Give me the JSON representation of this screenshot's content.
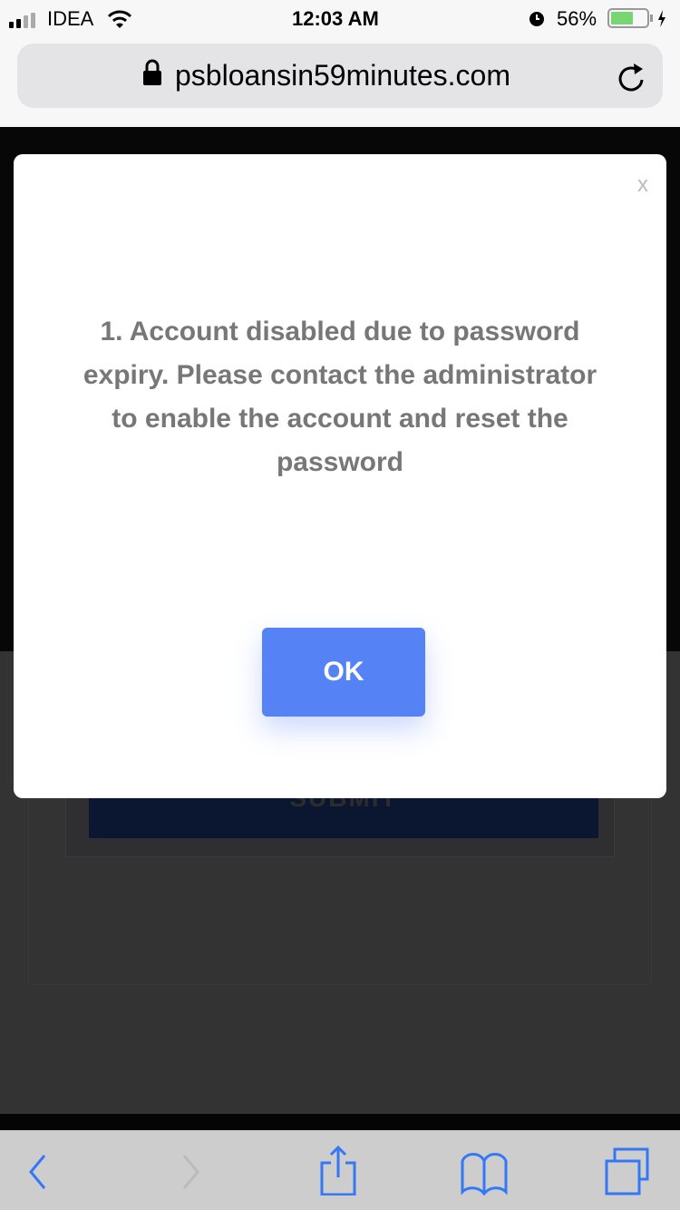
{
  "status_bar": {
    "carrier": "IDEA",
    "time": "12:03 AM",
    "battery": "56%",
    "battery_level": 0.56
  },
  "browser": {
    "url": "psbloansin59minutes.com"
  },
  "page": {
    "submit_label": "SUBMIT"
  },
  "modal": {
    "close_label": "x",
    "message": "1. Account disabled due to password expiry. Please contact the administrator to enable the account and reset the password",
    "ok_label": "OK"
  },
  "colors": {
    "accent": "#5582f5",
    "ios_blue": "#3478f6"
  }
}
